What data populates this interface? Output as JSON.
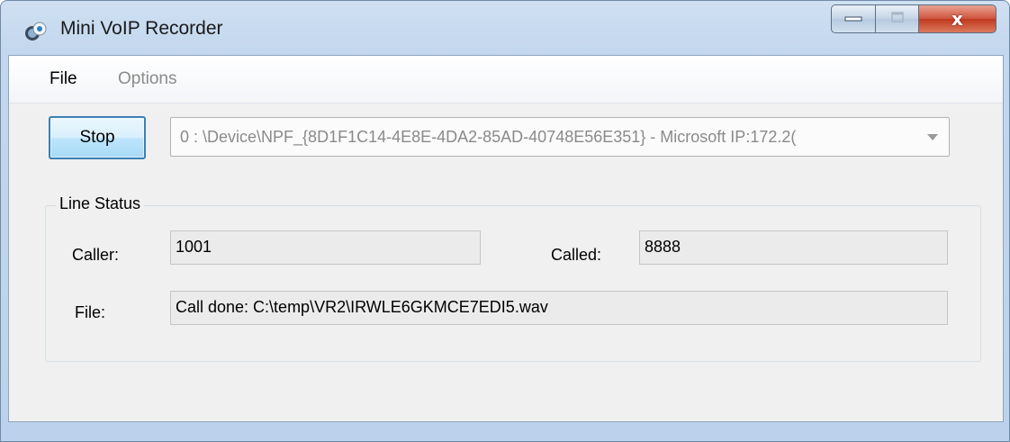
{
  "window": {
    "title": "Mini VoIP Recorder",
    "icon": "app-recorder-icon",
    "caption_buttons": [
      "minimize-icon",
      "maximize-icon",
      "close-icon"
    ],
    "close_glyph": "x"
  },
  "menu": {
    "items": [
      {
        "label": "File",
        "enabled": true
      },
      {
        "label": "Options",
        "enabled": false
      }
    ]
  },
  "toolbar": {
    "stop_label": "Stop",
    "device_value": "0 : \\Device\\NPF_{8D1F1C14-4E8E-4DA2-85AD-40748E56E351} - Microsoft IP:172.2("
  },
  "line_status": {
    "title": "Line Status",
    "caller_label": "Caller:",
    "caller_value": "1001",
    "called_label": "Called:",
    "called_value": "8888",
    "file_label": "File:",
    "file_value": "Call done: C:\\temp\\VR2\\IRWLE6GKMCE7EDI5.wav"
  },
  "colors": {
    "title_bar": "#c3d7ee",
    "client_bg": "#f0f0f0",
    "close_button": "#c0391f",
    "button_border": "#3c7fb1"
  }
}
